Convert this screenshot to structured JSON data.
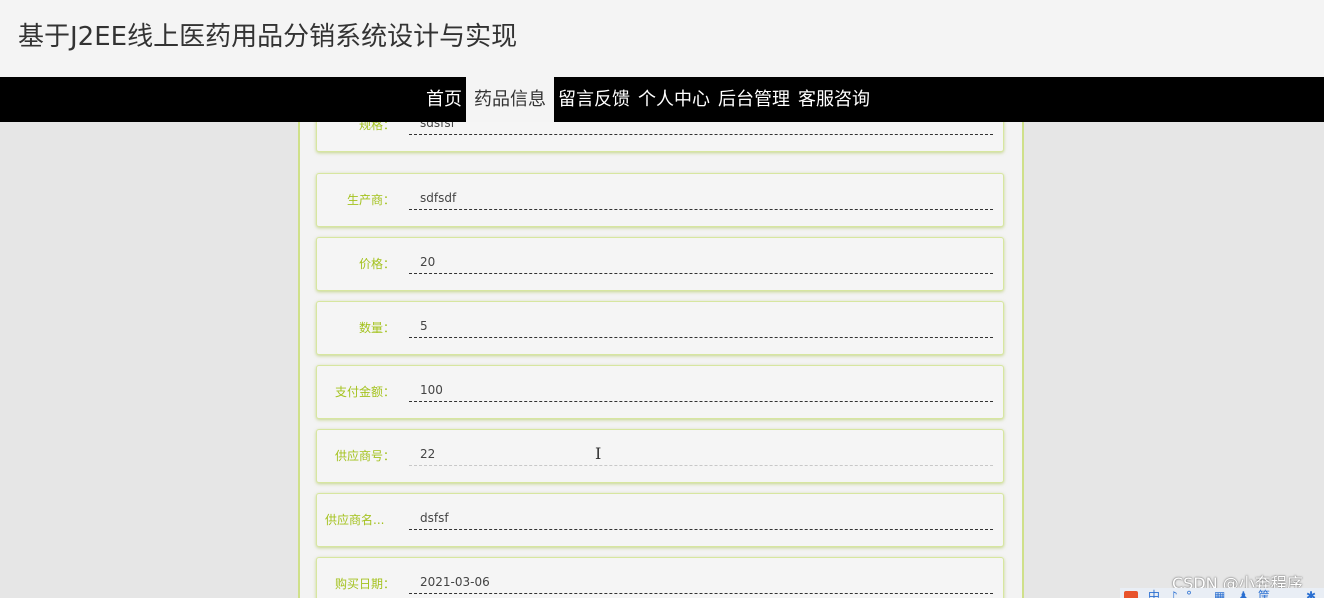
{
  "header": {
    "title": "基于J2EE线上医药用品分销系统设计与实现"
  },
  "nav": {
    "items": [
      {
        "label": "首页"
      },
      {
        "label": "药品信息"
      },
      {
        "label": "留言反馈"
      },
      {
        "label": "个人中心"
      },
      {
        "label": "后台管理"
      },
      {
        "label": "客服咨询"
      }
    ],
    "active": "药品信息"
  },
  "fields": [
    {
      "label": "规格：",
      "value": "sdsfsf"
    },
    {
      "label": "生产商：",
      "value": "sdfsdf"
    },
    {
      "label": "价格：",
      "value": "20"
    },
    {
      "label": "数量：",
      "value": "5"
    },
    {
      "label": "支付金额：",
      "value": "100"
    },
    {
      "label": "供应商号：",
      "value": "22"
    },
    {
      "label": "供应商名...",
      "value": "dsfsf"
    },
    {
      "label": "购买日期：",
      "value": "2021-03-06"
    }
  ],
  "watermark": {
    "text": "CSDN @小奔程序"
  },
  "ime": {
    "glyphs": [
      "中",
      "♪",
      "°",
      "▦",
      "♟",
      "筐",
      "✱"
    ]
  },
  "colors": {
    "label_accent": "#a4c21e",
    "card_border": "#d7e6a0",
    "nav_background": "#000000"
  }
}
